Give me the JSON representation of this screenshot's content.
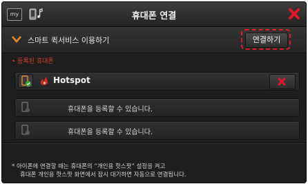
{
  "window": {
    "title": "휴대폰 연결",
    "my_icon_label": "my"
  },
  "quick_service": {
    "label": "스마트 퀵서비스 이용하기",
    "connect_button": "연결하기"
  },
  "registered": {
    "section_label": "• 등록된 휴대폰",
    "devices": [
      {
        "name": "Hotspot",
        "connected": true
      },
      {
        "placeholder": "휴대폰을 등록할 수 있습니다."
      },
      {
        "placeholder": "휴대폰을 등록할 수 있습니다."
      }
    ]
  },
  "notice": {
    "line1": "* 아이폰에 연결할 때는 휴대폰의 “개인용 핫스팟” 설정을 켜고",
    "line2": "휴대폰 개인용 핫스팟 화면에서 잠시 대기하면 자동으로 연결됩니다."
  },
  "colors": {
    "accent_red": "#e2182a",
    "chevron_orange": "#e8862a",
    "connected_green": "#3aa435",
    "background": "#1e1e1e"
  },
  "icons": [
    "my-icon",
    "phone-music-icon",
    "close-icon",
    "chevron-down-icon",
    "phone-icon",
    "hotspot-icon",
    "delete-icon"
  ]
}
